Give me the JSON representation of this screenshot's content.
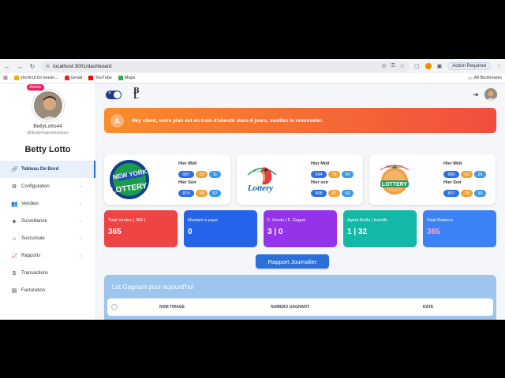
{
  "browser": {
    "url": "localhost:3001/dashboard",
    "action_required": "Action Required",
    "bookmarks": [
      {
        "label": "shortcut for leavin...",
        "color": "#e8b400"
      },
      {
        "label": "Gmail",
        "color": "#d93025"
      },
      {
        "label": "YouTube",
        "color": "#ff0000"
      },
      {
        "label": "Maps",
        "color": "#34a853"
      }
    ],
    "all_bookmarks": "All Bookmarks"
  },
  "sidebar": {
    "badge": "Admin",
    "username": "BettyLotto44",
    "handle": "@Betty#administrator",
    "brand": "Betty Lotto",
    "items": [
      {
        "label": "Tableau De Bord",
        "icon": "link-icon",
        "glyph": "🔗",
        "active": true,
        "chevron": false
      },
      {
        "label": "Configuration",
        "icon": "gear-icon",
        "glyph": "⚙",
        "active": false,
        "chevron": true
      },
      {
        "label": "Vendeur",
        "icon": "users-icon",
        "glyph": "👥",
        "active": false,
        "chevron": true
      },
      {
        "label": "Surveillance",
        "icon": "shield-icon",
        "glyph": "◈",
        "active": false,
        "chevron": true
      },
      {
        "label": "Succursale",
        "icon": "home-icon",
        "glyph": "⌂",
        "active": false,
        "chevron": true
      },
      {
        "label": "Rapports",
        "icon": "chart-icon",
        "glyph": "📈",
        "active": false,
        "chevron": true
      },
      {
        "label": "Transactions",
        "icon": "dollar-icon",
        "glyph": "$",
        "active": false,
        "chevron": false
      },
      {
        "label": "Facturation",
        "icon": "invoice-icon",
        "glyph": "▤",
        "active": false,
        "chevron": false
      }
    ]
  },
  "alert": {
    "text": "Hey client, votre plan est en train d'aboutir dans 6 jours, veuillez le renouveler."
  },
  "lotteries": [
    {
      "logo": "ny-lottery-logo",
      "midi_label": "Hier Midi",
      "midi": [
        "087",
        "23",
        "11"
      ],
      "soir_label": "Hier Soir",
      "soir": [
        "874",
        "98",
        "67"
      ]
    },
    {
      "logo": "florida-lottery-logo",
      "midi_label": "Hier Midi",
      "midi": [
        "564",
        "78",
        "90"
      ],
      "soir_label": "Hier soir",
      "soir": [
        "908",
        "87",
        "65"
      ]
    },
    {
      "logo": "georgia-lottery-logo",
      "midi_label": "Hier Midi",
      "midi": [
        "980",
        "61",
        "26"
      ],
      "soir_label": "Hier Soir",
      "soir": [
        "807",
        "78",
        "90"
      ]
    }
  ],
  "stats": [
    {
      "label": "Total Ventes ( 366 )",
      "value": "365",
      "bg": "#ef4444",
      "value_color": "#ffffff"
    },
    {
      "label": "Montant a paye",
      "value": "0",
      "bg": "#2563eb",
      "value_color": "#ffffff"
    },
    {
      "label": "F. Vendu | F. Gagné",
      "value": "3 | 0",
      "bg": "#9333ea",
      "value_color": "#ffffff"
    },
    {
      "label": "Agent Actifs | Inactifs",
      "value": "1 | 32",
      "bg": "#14b8a6",
      "value_color": "#ffffff"
    },
    {
      "label": "Total Balance",
      "value": "365",
      "bg": "#3b82f6",
      "value_color": "#f9a8d4"
    }
  ],
  "report_button": "Rapport Journalier",
  "winners": {
    "title": "Lot Gagnant pour aujourd'hui",
    "columns": [
      "NOM TIRAGE",
      "NUMERO GAGNANT",
      "DATE"
    ]
  }
}
